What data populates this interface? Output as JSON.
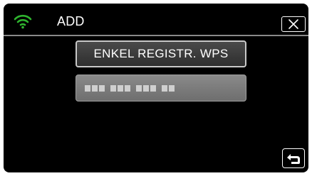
{
  "header": {
    "title": "ADD",
    "wifi_icon": "wifi-icon",
    "wifi_color": "#2fb52f",
    "close_icon": "close-icon"
  },
  "options": {
    "wps_label": "ENKEL REGISTR. WPS",
    "masked_option_icon": "masked-text"
  },
  "footer": {
    "back_icon": "back-arrow-icon"
  }
}
